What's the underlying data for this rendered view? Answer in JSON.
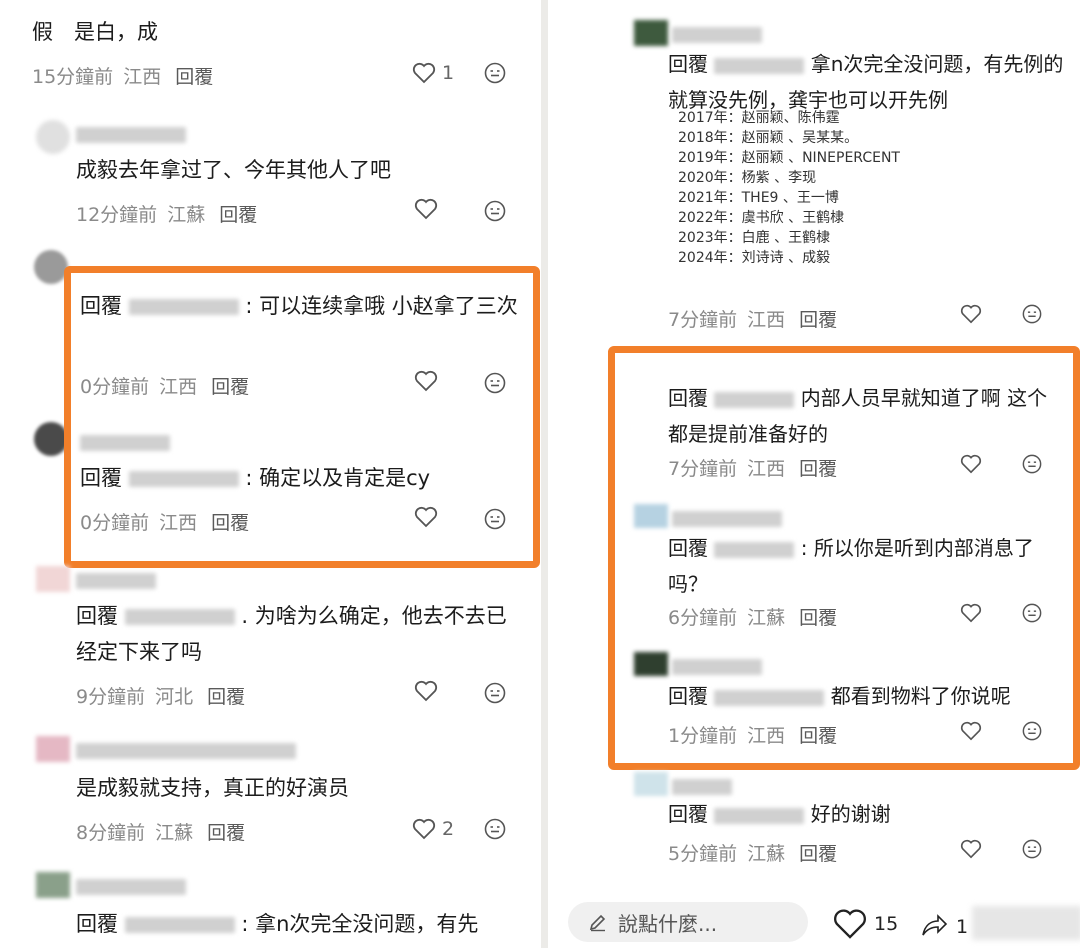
{
  "left": {
    "top_fragment": "假　是白，成",
    "comments": [
      {
        "time": "15分鐘前",
        "loc": "江西",
        "reply": "回覆",
        "likes": "1"
      },
      {
        "text": "成毅去年拿过了、今年其他人了吧",
        "time": "12分鐘前",
        "loc": "江蘇",
        "reply": "回覆"
      },
      {
        "prefix": "回覆",
        "text": ": 可以连续拿哦  小赵拿了三次",
        "time": "0分鐘前",
        "loc": "江西",
        "reply": "回覆"
      },
      {
        "prefix": "回覆",
        "text": ": 确定以及肯定是cy",
        "time": "0分鐘前",
        "loc": "江西",
        "reply": "回覆"
      },
      {
        "prefix": "回覆",
        "text": ". 为啥为么确定，他去不去已经定下来了吗",
        "time": "9分鐘前",
        "loc": "河北",
        "reply": "回覆"
      },
      {
        "text": "是成毅就支持，真正的好演员",
        "time": "8分鐘前",
        "loc": "江蘇",
        "reply": "回覆",
        "likes": "2"
      },
      {
        "prefix": "回覆",
        "text": ": 拿n次完全没问题，有先"
      }
    ]
  },
  "right": {
    "comments": [
      {
        "prefix": "回覆",
        "text": "拿n次完全没问题，有先例的  就算没先例，龚宇也可以开先例",
        "time": "7分鐘前",
        "loc": "江西",
        "reply": "回覆"
      },
      {
        "prefix": "回覆",
        "text": "内部人员早就知道了啊  这个都是提前准备好的",
        "time": "7分鐘前",
        "loc": "江西",
        "reply": "回覆"
      },
      {
        "prefix": "回覆",
        "text": ": 所以你是听到内部消息了吗？",
        "time": "6分鐘前",
        "loc": "江蘇",
        "reply": "回覆"
      },
      {
        "prefix": "回覆",
        "text": "都看到物料了你说呢",
        "time": "1分鐘前",
        "loc": "江西",
        "reply": "回覆"
      },
      {
        "prefix": "回覆",
        "text": "好的谢谢",
        "time": "5分鐘前",
        "loc": "江蘇",
        "reply": "回覆"
      }
    ],
    "year_list": [
      "2017年：赵丽颖、陈伟霆",
      "2018年：赵丽颖 、吴某某。",
      "2019年：赵丽颖 、NINEPERCENT",
      "2020年：杨紫 、李现",
      "2021年：THE9 、王一博",
      "2022年：虞书欣 、王鹤棣",
      "2023年：白鹿 、王鹤棣",
      "2024年：刘诗诗 、成毅"
    ],
    "bottom": {
      "say_placeholder": "說點什麼...",
      "like_count": "15",
      "share_count": "1"
    }
  },
  "colors": {
    "highlight": "#f27f2a",
    "meta": "#8a8a8a"
  },
  "icons": [
    "heart-icon",
    "emoji-icon",
    "pencil-icon",
    "share-icon"
  ]
}
